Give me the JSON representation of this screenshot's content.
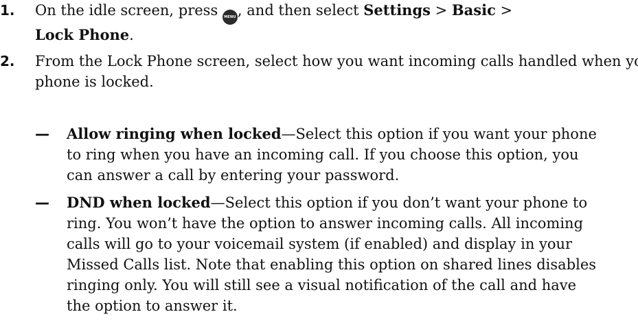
{
  "steps": [
    {
      "number": "1.",
      "text_before_icon": "On the idle screen, press ",
      "icon_label": "MENU",
      "text_after_icon": ", and then select ",
      "settings": "Settings",
      "sep1": " > ",
      "basic": "Basic",
      "sep2": " >",
      "lock_phone": "Lock Phone",
      "end": "."
    },
    {
      "number": "2.",
      "text": "From the Lock Phone screen, select how you want incoming calls handled when your phone is locked."
    }
  ],
  "options": [
    {
      "dash": "—",
      "title": "Allow ringing when locked",
      "desc": "—Select this option if you want your phone to ring when you have an incoming call. If you choose this option, you can answer a call by entering your password."
    },
    {
      "dash": "—",
      "title": "DND when locked",
      "desc": "—Select this option if you don’t want your phone to ring. You won’t have the option to answer incoming calls. All incoming calls will go to your voicemail system (if enabled) and display in your Missed Calls list. Note that enabling this option on shared lines disables ringing only. You will still see a visual notification of the call and have the option to answer it."
    }
  ]
}
